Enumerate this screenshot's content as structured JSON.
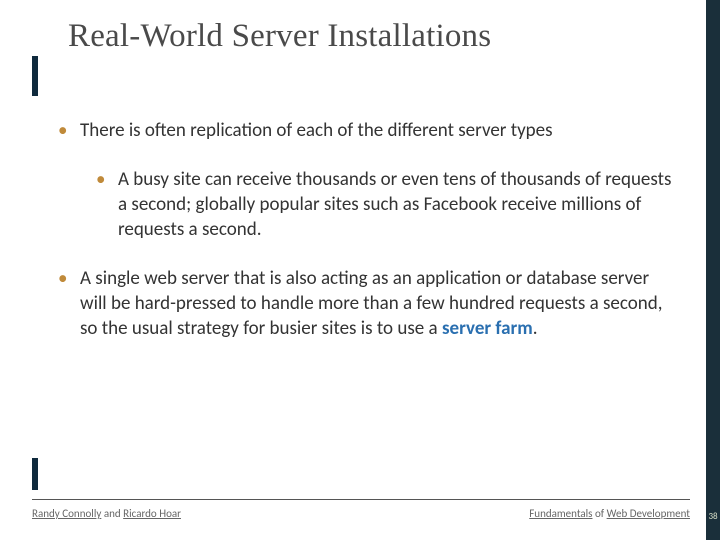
{
  "title": "Real-World Server Installations",
  "bullets": {
    "b1": "There is often replication of each of the different server types",
    "b1a": "A busy site can receive thousands or even tens of thousands of requests a second; globally popular sites such as Facebook receive millions of requests a second.",
    "b2_pre": "A single web server that is also acting as an application or database server will be hard-pressed to handle more than a few hundred requests a second, so the usual strategy for busier sites is to use a ",
    "b2_term": "server farm",
    "b2_post": "."
  },
  "footer": {
    "left_a": "Randy Connolly",
    "left_mid": " and ",
    "left_b": "Ricardo Hoar",
    "right_a": "Fundamentals",
    "right_mid": " of ",
    "right_b": "Web Development"
  },
  "pagenum": "38"
}
